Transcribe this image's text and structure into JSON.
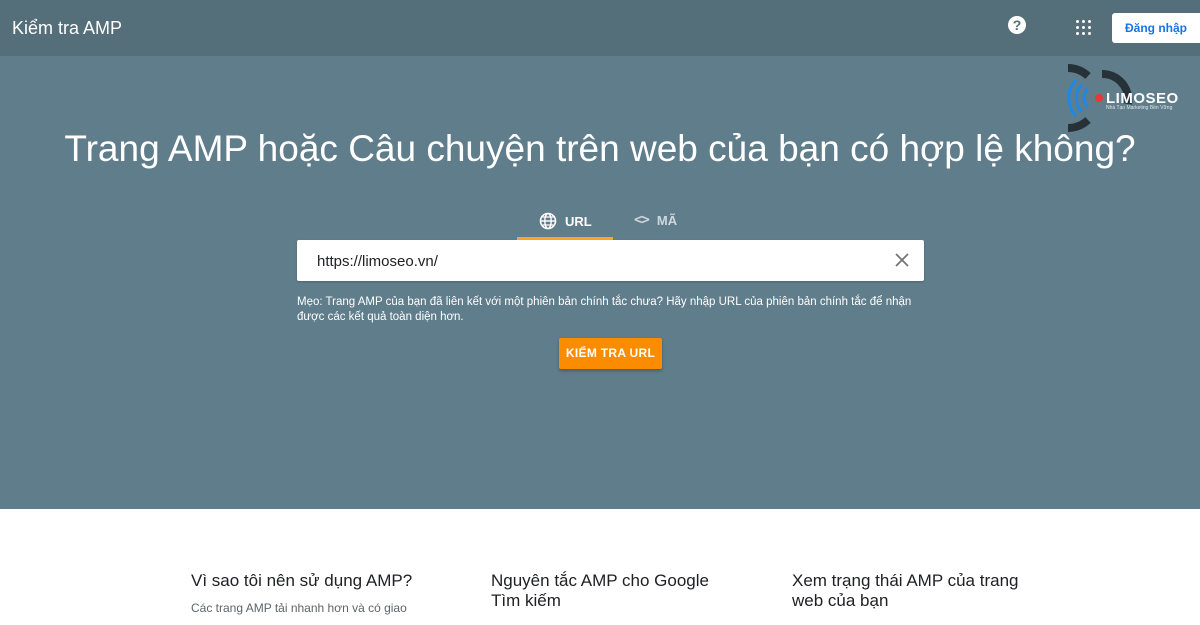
{
  "header": {
    "app_title": "Kiểm tra AMP",
    "help_icon": "help-circle-icon",
    "apps_icon": "apps-grid-icon",
    "signin_label": "Đăng nhập"
  },
  "logo": {
    "text": "LIMOSEO",
    "subtitle": "Nhà Tạo Marketing Bền Vững"
  },
  "hero": {
    "headline": "Trang AMP hoặc Câu chuyện trên web của bạn có hợp lệ không?",
    "tabs": [
      {
        "label": "URL",
        "icon": "globe-icon",
        "active": true
      },
      {
        "label": "MÃ",
        "icon": "code-icon",
        "active": false
      }
    ],
    "url_input": {
      "value": "https://limoseo.vn/",
      "clear_icon": "close-icon"
    },
    "tip": "Mẹo: Trang AMP của bạn đã liên kết với một phiên bản chính tắc chưa? Hãy nhập URL của phiên bản chính tắc để nhận được các kết quả toàn diện hơn.",
    "check_button_label": "KIỂM TRA URL"
  },
  "cards": [
    {
      "title": "Vì sao tôi nên sử dụng AMP?",
      "text": "Các trang AMP tải nhanh hơn và có giao"
    },
    {
      "title": "Nguyên tắc AMP cho Google Tìm kiếm",
      "text": ""
    },
    {
      "title": "Xem trạng thái AMP của trang web của bạn",
      "text": ""
    }
  ],
  "colors": {
    "header_bg": "#546e7a",
    "hero_bg": "#607d8b",
    "accent": "#fb8c00",
    "tab_indicator": "#f9a825",
    "signin_text": "#1a73e8"
  }
}
